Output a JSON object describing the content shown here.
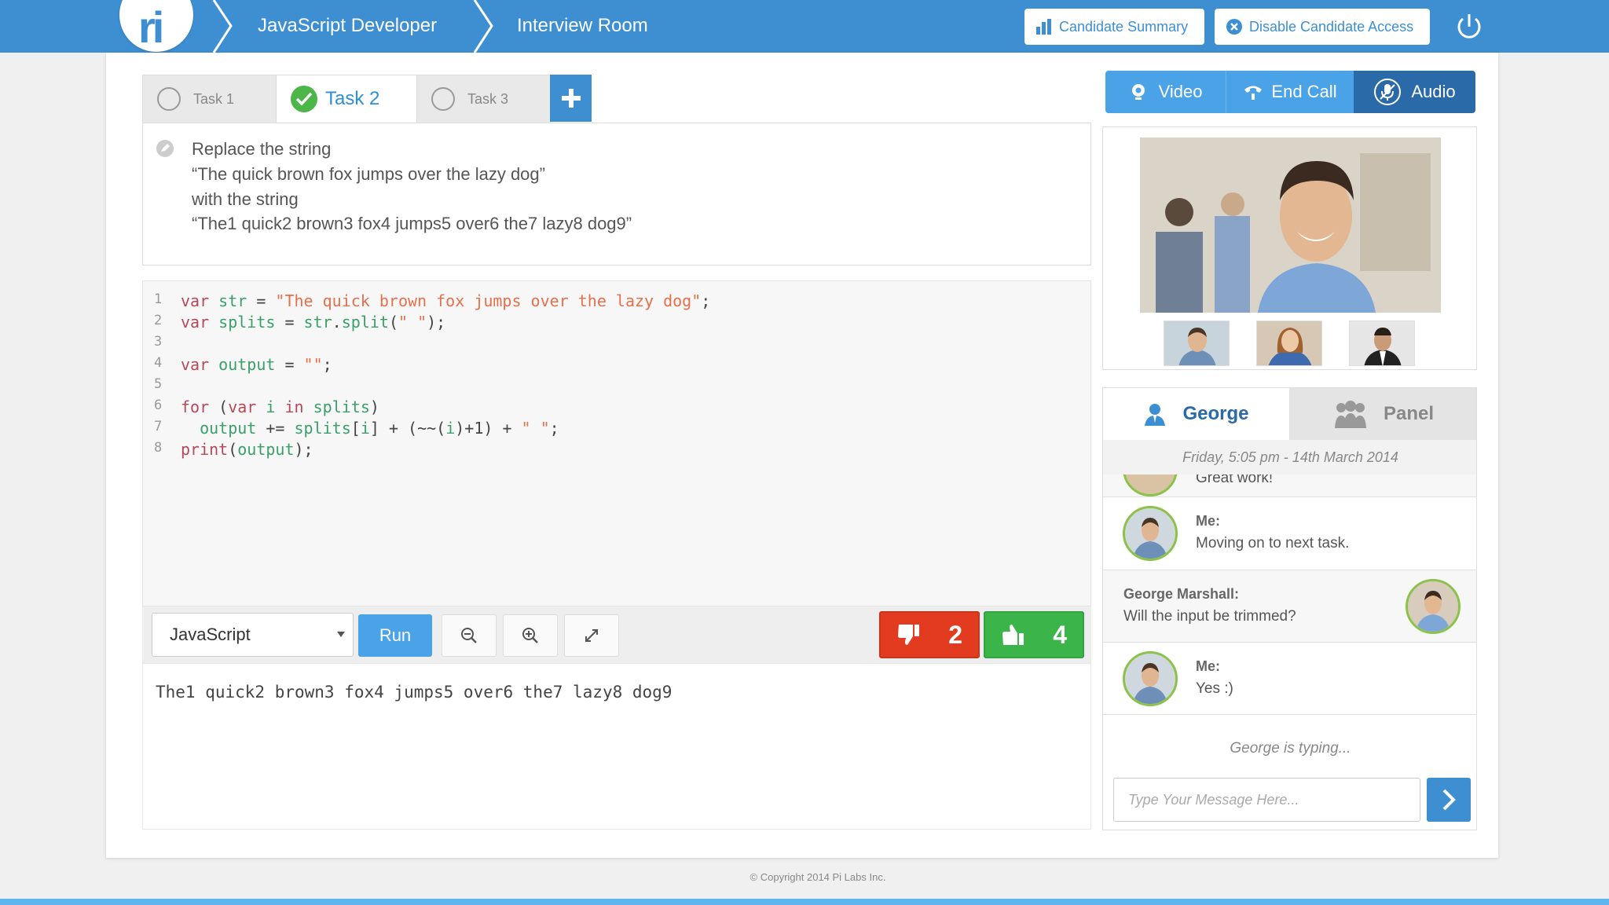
{
  "colors": {
    "brand": "#3d8fd2",
    "success": "#4cb649",
    "danger": "#e33b1f",
    "accent": "#4aa3e6",
    "dark_blue": "#2b6aa8"
  },
  "header": {
    "logo_text": "ri",
    "breadcrumb": [
      "JavaScript Developer",
      "Interview Room"
    ],
    "candidate_summary_label": "Candidate Summary",
    "disable_access_label": "Disable Candidate Access",
    "power_icon": "power-icon"
  },
  "tasks": {
    "items": [
      {
        "label": "Task 1",
        "state": "pending"
      },
      {
        "label": "Task 2",
        "state": "completed",
        "active": true
      },
      {
        "label": "Task 3",
        "state": "pending"
      }
    ],
    "add_icon": "plus-icon"
  },
  "task_description": {
    "lines": [
      "Replace the string",
      "“The quick brown fox jumps over the lazy dog”",
      "with the string",
      "“The1 quick2 brown3 fox4 jumps5 over6 the7 lazy8 dog9”"
    ]
  },
  "editor": {
    "line_numbers": [
      "1",
      "2",
      "3",
      "4",
      "5",
      "6",
      "7",
      "8"
    ],
    "lines": [
      "var str = \"The quick brown fox jumps over the lazy dog\";",
      "var splits = str.split(\" \");",
      "",
      "var output = \"\";",
      "",
      "for (var i in splits)",
      "  output += splits[i] + (~~(i)+1) + \" \";",
      "print(output);"
    ]
  },
  "toolbar": {
    "language": "JavaScript",
    "run_label": "Run",
    "thumbs_down_count": "2",
    "thumbs_up_count": "4"
  },
  "output": {
    "text": "The1 quick2 brown3 fox4 jumps5 over6 the7 lazy8 dog9"
  },
  "media": {
    "video_label": "Video",
    "end_call_label": "End Call",
    "audio_label": "Audio"
  },
  "chat": {
    "tabs": [
      "George",
      "Panel"
    ],
    "date": "Friday, 5:05 pm - 14th March 2014",
    "messages": [
      {
        "name": "",
        "text": "Great work!"
      },
      {
        "name": "Me:",
        "text": "Moving on to next task."
      },
      {
        "name": "George Marshall:",
        "text": "Will the input be trimmed?"
      },
      {
        "name": "Me:",
        "text": "Yes :)"
      }
    ],
    "typing": "George is typing...",
    "input_placeholder": "Type Your Message Here..."
  },
  "footer": {
    "copyright": "Copyright 2014 Pi Labs Inc."
  }
}
